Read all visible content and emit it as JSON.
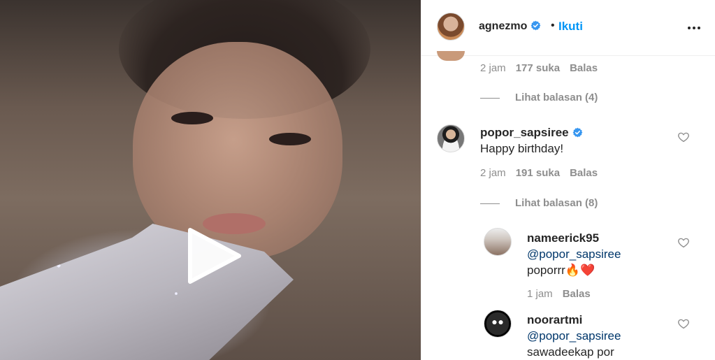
{
  "header": {
    "username": "agnezmo",
    "separator": "•",
    "follow_label": "Ikuti"
  },
  "comments": {
    "first_meta": {
      "time": "2 jam",
      "likes": "177 suka",
      "reply": "Balas"
    },
    "first_view_replies": "Lihat balasan (4)",
    "popor": {
      "username": "popor_sapsiree",
      "text": "Happy birthday!",
      "time": "2 jam",
      "likes": "191 suka",
      "reply": "Balas",
      "view_replies": "Lihat balasan (8)"
    },
    "replies": [
      {
        "username": "nameerick95",
        "mention": "@popor_sapsiree",
        "text": "poporrr🔥❤️",
        "time": "1 jam",
        "reply": "Balas"
      },
      {
        "username": "noorartmi",
        "mention": "@popor_sapsiree",
        "text": "sawadeekap por"
      }
    ]
  },
  "colors": {
    "link_blue": "#0095f6",
    "mention_blue": "#00376b",
    "verified_blue": "#3897f0",
    "secondary_text": "#8e8e8e"
  },
  "icons": [
    "verified-badge-icon",
    "more-options-icon",
    "heart-icon",
    "play-icon"
  ]
}
